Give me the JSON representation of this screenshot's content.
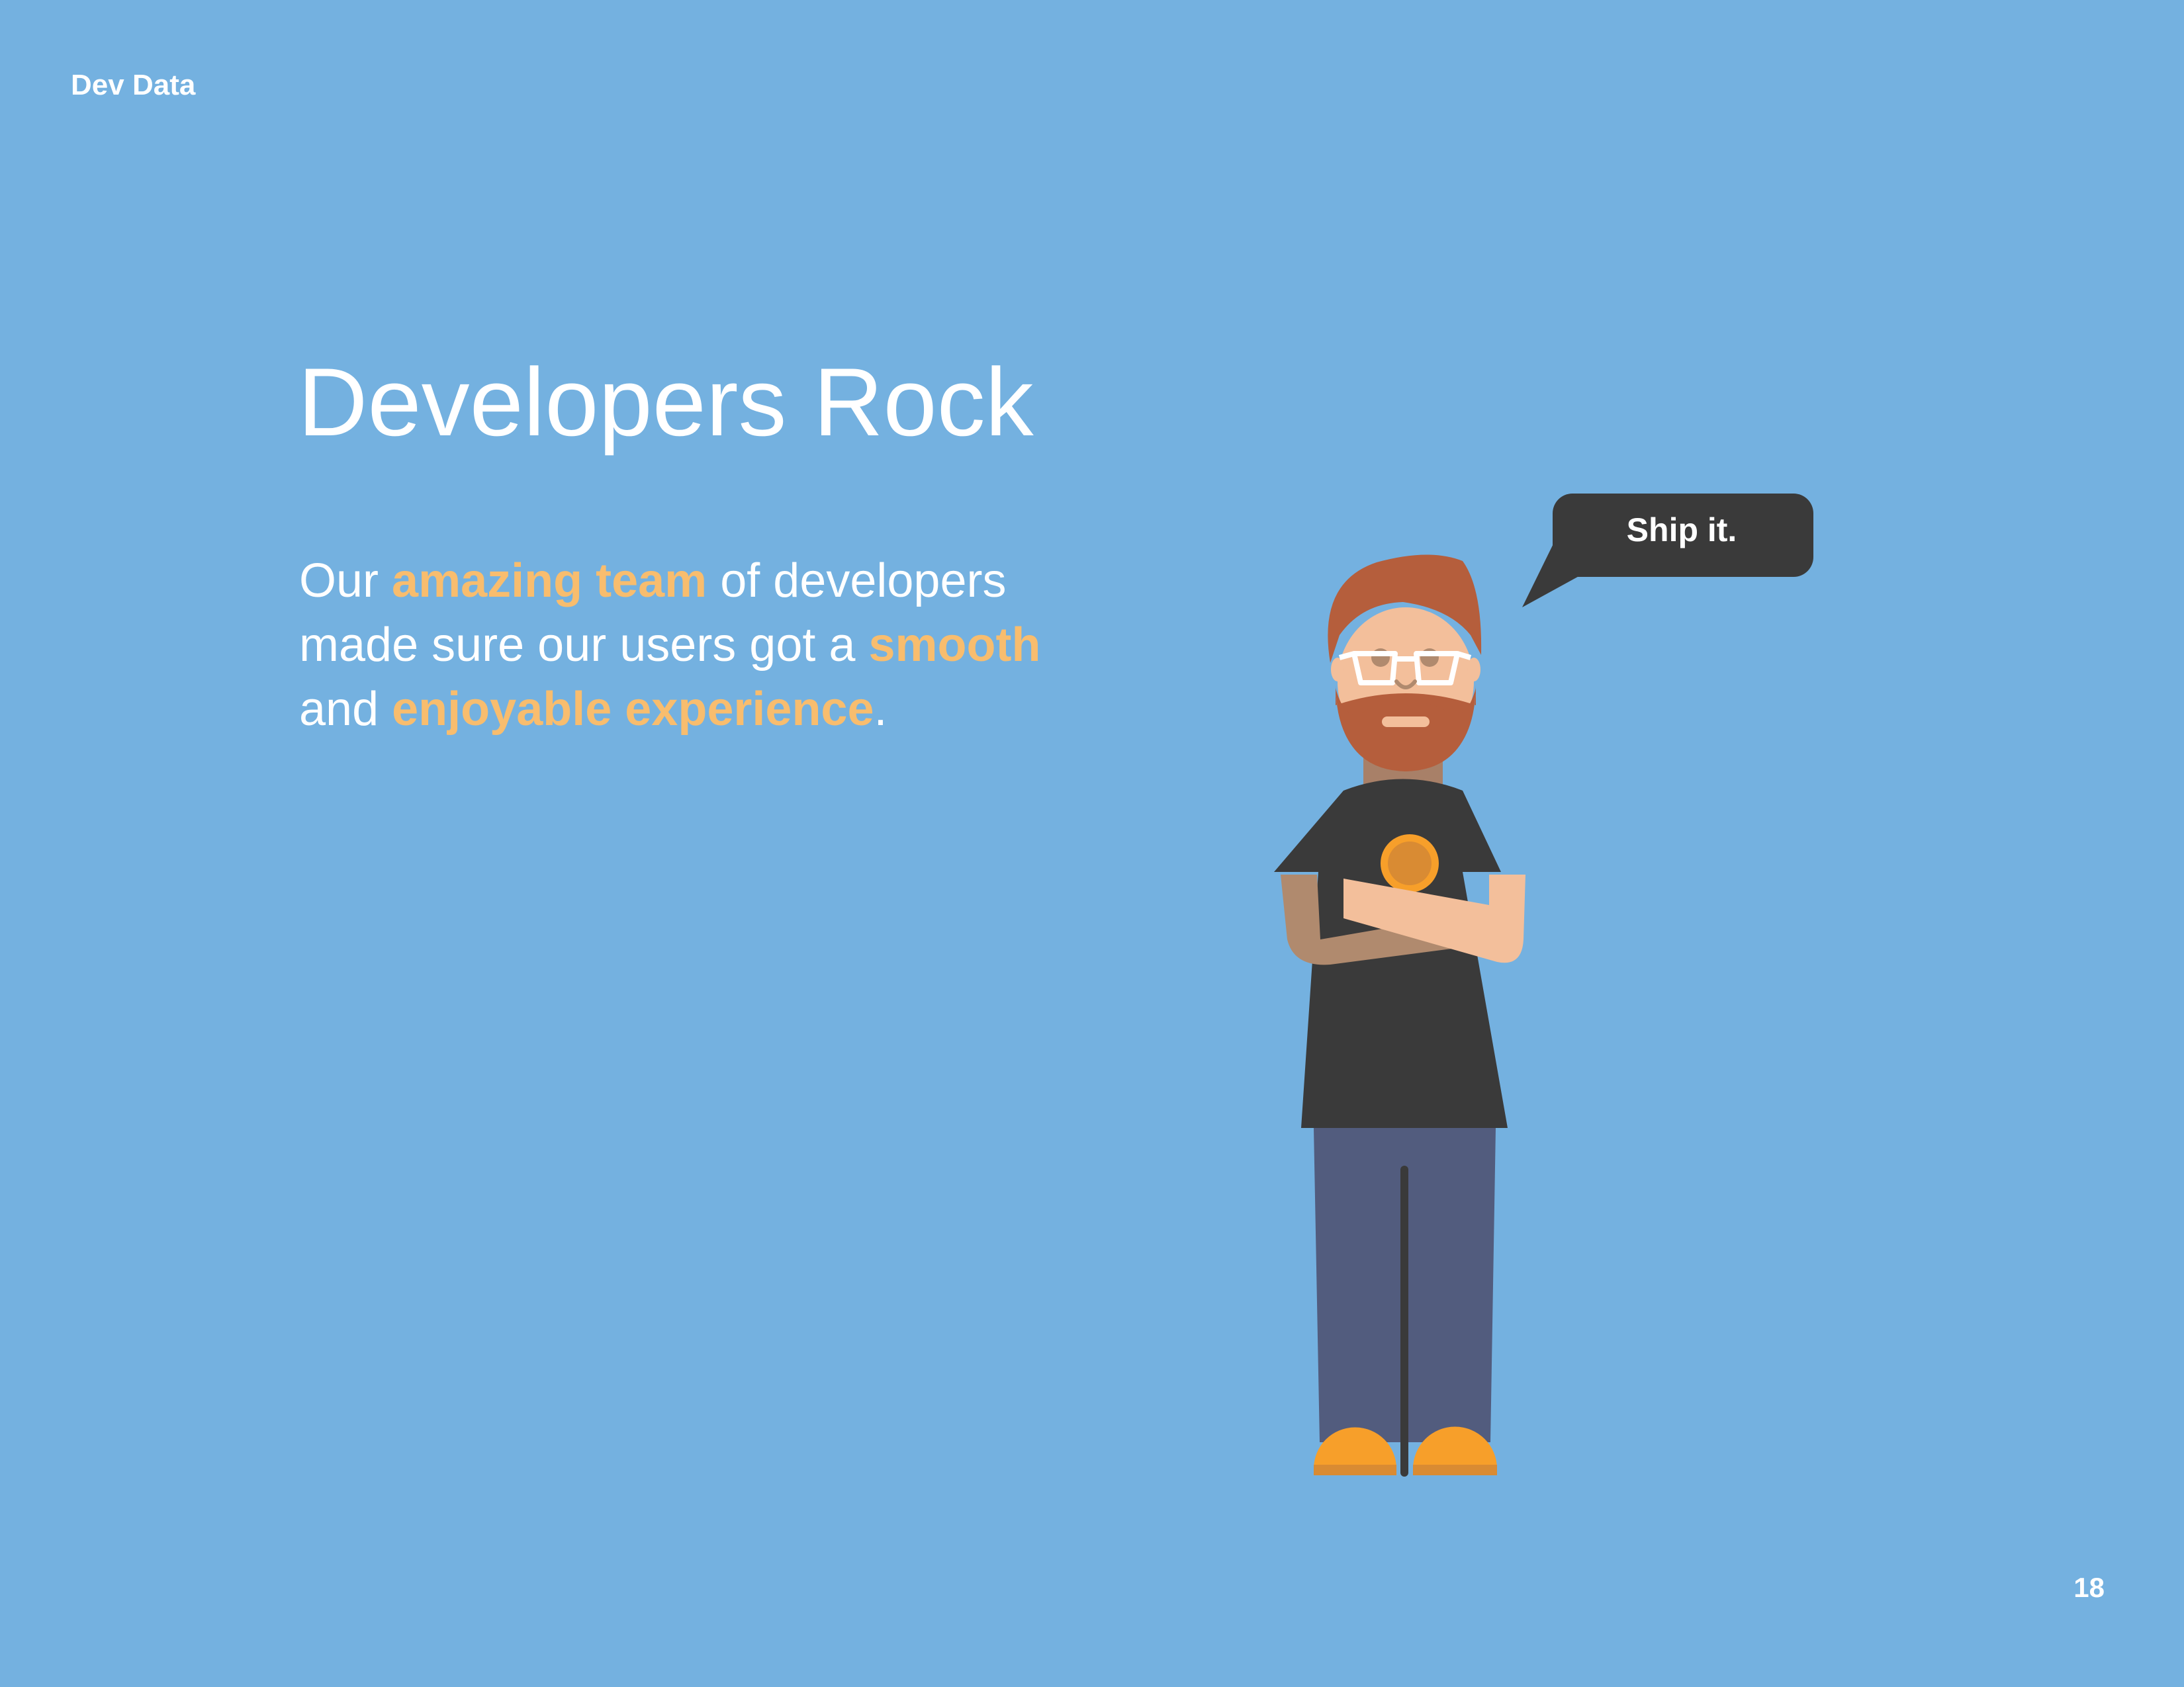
{
  "header": {
    "label": "Dev Data"
  },
  "slide": {
    "title": "Developers Rock",
    "body": {
      "line1_a": "Our ",
      "line1_hl": "amazing team",
      "line1_b": " of developers",
      "line2_a": "made sure our users got a ",
      "line2_hl": "smooth",
      "line3_a": "and ",
      "line3_hl": "enjoyable experience",
      "line3_b": "."
    },
    "speech_bubble": "Ship it."
  },
  "footer": {
    "page_number": "18"
  },
  "colors": {
    "background": "#74b1e0",
    "highlight": "#f8bd6e",
    "bubble": "#3a3a3a",
    "shirt": "#3a3a3a",
    "pants": "#525c7e",
    "shoes": "#f79f2a",
    "hair": "#b55e3c",
    "skin": "#f3bf9b"
  },
  "icons": {
    "figure": "developer-character-illustration",
    "bubble": "speech-bubble-icon"
  }
}
